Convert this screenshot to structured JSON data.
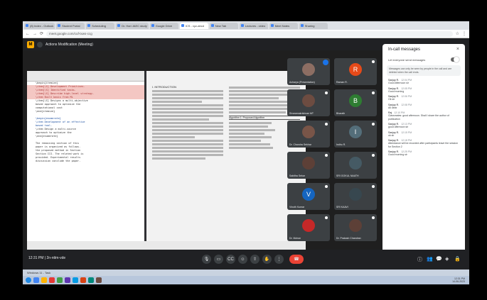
{
  "browser": {
    "tabs": [
      {
        "label": "(8) Index - Outlook"
      },
      {
        "label": "Student Portal"
      },
      {
        "label": "Scheduling"
      },
      {
        "label": "Dr. Hari JAEC study"
      },
      {
        "label": "Google Drive"
      },
      {
        "label": "ICS - xyz-abcd",
        "active": true
      },
      {
        "label": "New Tab"
      },
      {
        "label": "Lectures - video"
      },
      {
        "label": "Meet Notes"
      },
      {
        "label": "Sharing"
      }
    ],
    "url": "meet.google.com/cuf-txws-ccg"
  },
  "meet": {
    "title": "Actions Modification (Meeting)",
    "clock": "12:31 PM | 2n-nttm-vde"
  },
  "code_lines": [
    {
      "text": "\\begin{itemize}",
      "style": ""
    },
    {
      "text": "  \\item[\\S] Development Primitives.",
      "style": "hl"
    },
    {
      "text": "  \\item[\\S] Identified tasks.",
      "style": "hl"
    },
    {
      "text": "  \\item[\\S] Describe high-level strategy.",
      "style": "hl"
    },
    {
      "text": "  \\item Built basis from ML",
      "style": "hl"
    },
    {
      "text": "  \\item[\\S] Designs a multi-objective",
      "style": ""
    },
    {
      "text": "  based approach to optimize the",
      "style": ""
    },
    {
      "text": "  computational cost",
      "style": ""
    },
    {
      "text": "\\end{itemize}",
      "style": ""
    },
    {
      "text": "",
      "style": ""
    },
    {
      "text": "\\begin{enumerate}",
      "style": "blue"
    },
    {
      "text": "  \\item Development of an effective",
      "style": "blue"
    },
    {
      "text": "  based tool.",
      "style": "blue"
    },
    {
      "text": "  \\item Design a multi-source",
      "style": ""
    },
    {
      "text": "  approach to optimize the",
      "style": ""
    },
    {
      "text": "\\end{enumerate}",
      "style": ""
    },
    {
      "text": "",
      "style": ""
    },
    {
      "text": "The remaining section of this",
      "style": ""
    },
    {
      "text": "paper is organized as follows.",
      "style": ""
    },
    {
      "text": "the proposed method in Section",
      "style": ""
    },
    {
      "text": "Section III. The related work is",
      "style": ""
    },
    {
      "text": "provided. Experimental results",
      "style": ""
    },
    {
      "text": "discussion conclude the paper.",
      "style": ""
    }
  ],
  "pdf": {
    "heading": "I. INTRODUCTION",
    "algo_title": "Algorithm 1: Proposed Algorithm"
  },
  "participants": [
    {
      "name": "Acharya (Presentation)",
      "initial": "",
      "color": "#8d6e63",
      "speaking": true
    },
    {
      "name": "Raman R.",
      "initial": "R",
      "color": "#e64a19"
    },
    {
      "name": "Sivaramakrishnan MT",
      "initial": "",
      "color": "#6d4c41"
    },
    {
      "name": "Bharath",
      "initial": "B",
      "color": "#2e7d32"
    },
    {
      "name": "Dr. Chandra Sekhar",
      "initial": "",
      "color": "#795548"
    },
    {
      "name": "Indhu R.",
      "initial": "I",
      "color": "#546e7a"
    },
    {
      "name": "Sabitha Sekar",
      "initial": "",
      "color": "#5d4037"
    },
    {
      "name": "SRI GOKUL NAATH",
      "initial": "",
      "color": "#455a64"
    },
    {
      "name": "Vinoth Kumar",
      "initial": "V",
      "color": "#1565c0"
    },
    {
      "name": "SRI KAAVI",
      "initial": "",
      "color": "#37474f"
    },
    {
      "name": "Dr. Mohan",
      "initial": "",
      "color": "#c62828"
    },
    {
      "name": "Dr. Prakash Chandran",
      "initial": "",
      "color": "#5d4037"
    }
  ],
  "chat": {
    "title": "In-call messages",
    "toggle_label": "Let everyone send messages",
    "note": "Messages can only be seen by people in the call and are deleted when the call ends.",
    "messages": [
      {
        "who": "Sanjay R.",
        "time": "12:04 PM",
        "body": "Good afternoon sir"
      },
      {
        "who": "Sanjay R.",
        "time": "12:05 PM",
        "body": "Good morning"
      },
      {
        "who": "Sanjay R.",
        "time": "12:06 PM",
        "body": "Ok sir"
      },
      {
        "who": "Sanjay R.",
        "time": "12:08 PM",
        "body": "All clear"
      },
      {
        "who": "Raj",
        "time": "12:10 PM",
        "body": "Classmates: good afternoon. Shall I share the author of publication"
      },
      {
        "who": "Sanjay R.",
        "time": "12:13 PM",
        "body": "good afternoon sir"
      },
      {
        "who": "Sanjay R.",
        "time": "12:15 PM",
        "body": "ok sir"
      },
      {
        "who": "Sanjay R.",
        "time": "12:18 PM",
        "body": "Attendance will be recorded after participants leave the session for Section 2"
      },
      {
        "who": "Sanjay R.",
        "time": "12:25 PM",
        "body": "Good morning sir"
      }
    ],
    "input_placeholder": "Send a message"
  },
  "taskbar": {
    "label": "Windows 11 - Task",
    "time": "12:31 PM",
    "date": "14-06-2023"
  }
}
